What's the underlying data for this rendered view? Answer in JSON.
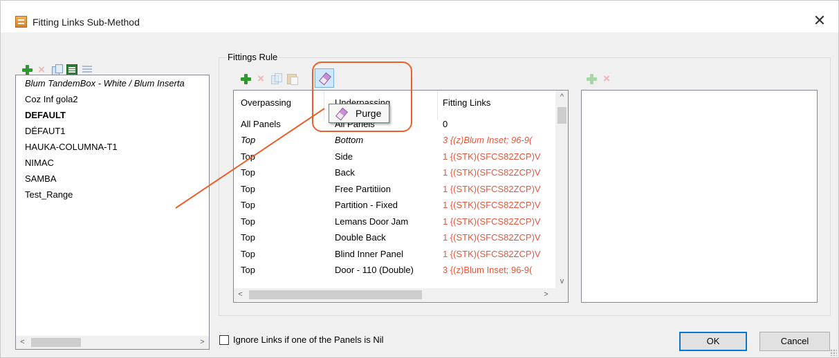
{
  "window": {
    "title": "Fitting Links Sub-Method",
    "close_glyph": "✕"
  },
  "left_toolbar": {
    "icons": [
      "plus-icon",
      "delete-icon",
      "copy-icon",
      "grid-icon",
      "list-icon"
    ]
  },
  "methods_list": {
    "items": [
      {
        "label": "Blum TandemBox - White / Blum Inserta",
        "style": "italic"
      },
      {
        "label": "Coz Inf gola2",
        "style": "normal"
      },
      {
        "label": "DEFAULT",
        "style": "bold"
      },
      {
        "label": "DÉFAUT1",
        "style": "normal"
      },
      {
        "label": "HAUKA-COLUMNA-T1",
        "style": "normal"
      },
      {
        "label": "NIMAC",
        "style": "normal"
      },
      {
        "label": "SAMBA",
        "style": "normal"
      },
      {
        "label": "Test_Range",
        "style": "normal"
      }
    ],
    "scroll_left": "<",
    "scroll_right": ">"
  },
  "fittings_rule": {
    "group_title": "Fittings Rule",
    "toolbar_icons": [
      "plus-icon",
      "delete-icon",
      "copy-icon",
      "paste-icon",
      "eraser-icon"
    ],
    "columns": [
      "Overpassing",
      "Underpassing",
      "Fitting Links"
    ],
    "header_visible_fragment": "Underpassing",
    "rows": [
      {
        "over": "All Panels",
        "under": "All Panels",
        "links": "0",
        "italic": false,
        "red": false
      },
      {
        "over": "Top",
        "under": "Bottom",
        "links": "3 {(z)Blum Inset; 96-9(",
        "italic": true,
        "red": true
      },
      {
        "over": "Top",
        "under": "Side",
        "links": "1 {(STK)(SFCS82ZCP)V",
        "italic": false,
        "red": true
      },
      {
        "over": "Top",
        "under": "Back",
        "links": "1 {(STK)(SFCS82ZCP)V",
        "italic": false,
        "red": true
      },
      {
        "over": "Top",
        "under": "Free Partitiion",
        "links": "1 {(STK)(SFCS82ZCP)V",
        "italic": false,
        "red": true
      },
      {
        "over": "Top",
        "under": "Partition - Fixed",
        "links": "1 {(STK)(SFCS82ZCP)V",
        "italic": false,
        "red": true
      },
      {
        "over": "Top",
        "under": "Lemans Door Jam",
        "links": "1 {(STK)(SFCS82ZCP)V",
        "italic": false,
        "red": true
      },
      {
        "over": "Top",
        "under": "Double Back",
        "links": "1 {(STK)(SFCS82ZCP)V",
        "italic": false,
        "red": true
      },
      {
        "over": "Top",
        "under": "Blind Inner Panel",
        "links": "1 {(STK)(SFCS82ZCP)V",
        "italic": false,
        "red": true
      },
      {
        "over": "Top",
        "under": "Door - 110 (Double)",
        "links": "3 {(z)Blum Inset; 96-9(",
        "italic": false,
        "red": true
      }
    ],
    "scroll_up": "^",
    "scroll_down": "v",
    "scroll_left": "<",
    "scroll_right": ">"
  },
  "purge_popup": {
    "label": "Purge",
    "icon": "eraser-icon"
  },
  "right_toolbar": {
    "icons": [
      "plus-icon",
      "delete-icon"
    ]
  },
  "options": {
    "ignore_links_label": "Ignore Links if one of the Panels is Nil",
    "ignore_links_checked": false
  },
  "buttons": {
    "ok": "OK",
    "cancel": "Cancel"
  },
  "colors": {
    "highlight": "#ec5e2a",
    "red_text": "#e8553a",
    "window_bg": "#f0f0f0"
  }
}
